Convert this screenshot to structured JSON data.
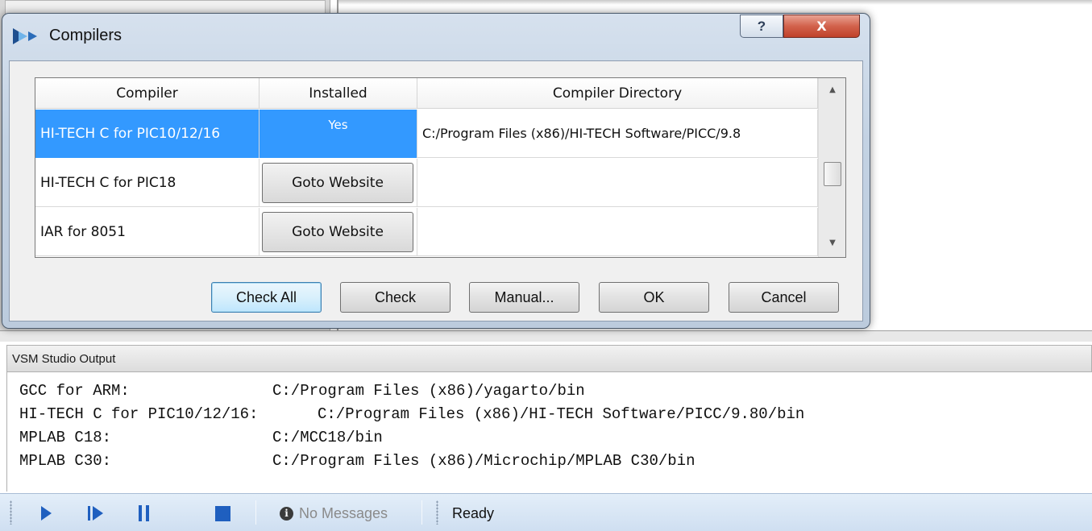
{
  "dialog": {
    "title": "Compilers",
    "help_label": "?",
    "close_label": "X",
    "columns": [
      "Compiler",
      "Installed",
      "Compiler Directory"
    ],
    "rows": [
      {
        "compiler": "HI-TECH C for PIC10/12/16",
        "installed": "Yes",
        "directory": "C:/Program Files (x86)/HI-TECH Software/PICC/9.8",
        "selected": true
      },
      {
        "compiler": "HI-TECH C for PIC18",
        "installed": "Goto Website",
        "directory": ""
      },
      {
        "compiler": "IAR for 8051",
        "installed": "Goto Website",
        "directory": ""
      }
    ],
    "buttons": {
      "check_all": "Check All",
      "check": "Check",
      "manual": "Manual...",
      "ok": "OK",
      "cancel": "Cancel"
    }
  },
  "output": {
    "title": "VSM Studio Output",
    "lines": [
      {
        "label": "GCC for ARM:",
        "path": "C:/Program Files (x86)/yagarto/bin"
      },
      {
        "label": "HI-TECH C for PIC10/12/16:",
        "path": "C:/Program Files (x86)/HI-TECH Software/PICC/9.80/bin"
      },
      {
        "label": "MPLAB C18:",
        "path": "C:/MCC18/bin"
      },
      {
        "label": "MPLAB C30:",
        "path": "C:/Program Files (x86)/Microchip/MPLAB C30/bin"
      }
    ]
  },
  "toolbar": {
    "messages": "No Messages",
    "status": "Ready",
    "accent": "#1f5fbf"
  },
  "colors": {
    "selection": "#3399ff",
    "close_red": "#c8472f"
  }
}
